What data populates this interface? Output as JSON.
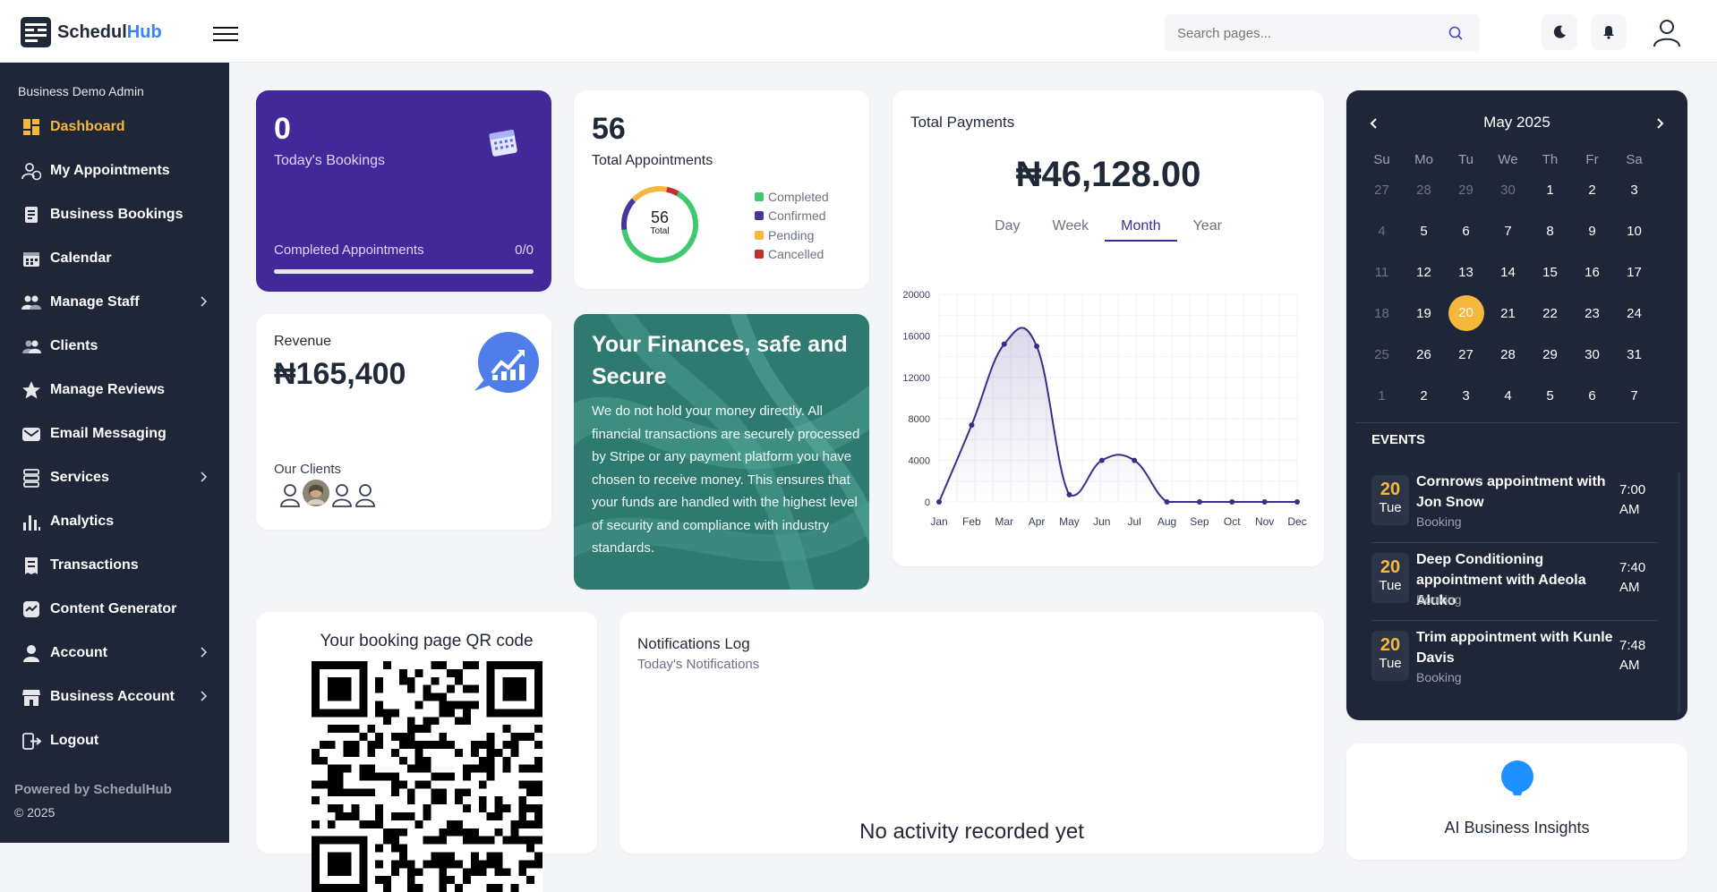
{
  "app": {
    "name_part1": "Schedul",
    "name_part2": "Hub",
    "search_placeholder": "Search pages..."
  },
  "sidebar": {
    "role": "Business Demo Admin",
    "items": [
      {
        "label": "Dashboard",
        "icon": "dashboard-icon",
        "active": true
      },
      {
        "label": "My Appointments",
        "icon": "user-clock-icon"
      },
      {
        "label": "Business Bookings",
        "icon": "booking-icon"
      },
      {
        "label": "Calendar",
        "icon": "calendar-icon"
      },
      {
        "label": "Manage Staff",
        "icon": "staff-icon",
        "chevron": true
      },
      {
        "label": "Clients",
        "icon": "clients-icon"
      },
      {
        "label": "Manage Reviews",
        "icon": "star-icon"
      },
      {
        "label": "Email Messaging",
        "icon": "mail-icon"
      },
      {
        "label": "Services",
        "icon": "services-icon",
        "chevron": true
      },
      {
        "label": "Analytics",
        "icon": "analytics-icon"
      },
      {
        "label": "Transactions",
        "icon": "receipt-icon"
      },
      {
        "label": "Content Generator",
        "icon": "content-icon"
      },
      {
        "label": "Account",
        "icon": "account-icon",
        "chevron": true
      },
      {
        "label": "Business Account",
        "icon": "store-icon",
        "chevron": true
      },
      {
        "label": "Logout",
        "icon": "logout-icon"
      }
    ],
    "powered_by": "Powered by SchedulHub",
    "copyright": "© 2025"
  },
  "bookings": {
    "count": "0",
    "label": "Today's Bookings",
    "completed_label": "Completed Appointments",
    "completed_ratio": "0/0",
    "progress": 0
  },
  "appointments": {
    "count": "56",
    "label": "Total Appointments",
    "donut_value": "56",
    "donut_label": "Total",
    "legend": [
      {
        "name": "Completed",
        "color": "#3ec96e",
        "value": 36
      },
      {
        "name": "Confirmed",
        "color": "#43389a",
        "value": 8
      },
      {
        "name": "Pending",
        "color": "#f6b83c",
        "value": 9
      },
      {
        "name": "Cancelled",
        "color": "#c42d2d",
        "value": 3
      }
    ]
  },
  "payments": {
    "title": "Total Payments",
    "amount": "₦46,128.00",
    "tabs": [
      "Day",
      "Week",
      "Month",
      "Year"
    ],
    "active_tab": "Month"
  },
  "revenue": {
    "label": "Revenue",
    "amount": "₦165,400",
    "clients_label": "Our Clients"
  },
  "finance": {
    "heading": "Your Finances, safe and Secure",
    "body": "We do not hold your money directly. All financial transactions are securely processed by Stripe or any payment platform you have chosen to receive money. This ensures that your funds are handled with the highest level of security and compliance with industry standards."
  },
  "calendar": {
    "month": "May 2025",
    "weekdays": [
      "Su",
      "Mo",
      "Tu",
      "We",
      "Th",
      "Fr",
      "Sa"
    ],
    "weeks": [
      [
        "27",
        "28",
        "29",
        "30",
        "1",
        "2",
        "3"
      ],
      [
        "4",
        "5",
        "6",
        "7",
        "8",
        "9",
        "10"
      ],
      [
        "11",
        "12",
        "13",
        "14",
        "15",
        "16",
        "17"
      ],
      [
        "18",
        "19",
        "20",
        "21",
        "22",
        "23",
        "24"
      ],
      [
        "25",
        "26",
        "27",
        "28",
        "29",
        "30",
        "31"
      ],
      [
        "1",
        "2",
        "3",
        "4",
        "5",
        "6",
        "7"
      ]
    ],
    "today": "20",
    "events_label": "EVENTS",
    "events": [
      {
        "day": "20",
        "weekday": "Tue",
        "title": "Cornrows appointment with Jon Snow",
        "type": "Booking",
        "time": "7:00 AM"
      },
      {
        "day": "20",
        "weekday": "Tue",
        "title": "Deep Conditioning appointment with Adeola Aluko",
        "type": "Booking",
        "time": "7:40 AM"
      },
      {
        "day": "20",
        "weekday": "Tue",
        "title": "Trim appointment with Kunle Davis",
        "type": "Booking",
        "time": "7:48 AM"
      }
    ]
  },
  "qr": {
    "title": "Your booking page QR code"
  },
  "notifications": {
    "title": "Notifications Log",
    "subtitle": "Today's Notifications",
    "empty": "No activity recorded yet"
  },
  "ai": {
    "title": "AI Business Insights"
  },
  "chart_data": {
    "type": "area",
    "categories": [
      "Jan",
      "Feb",
      "Mar",
      "Apr",
      "May",
      "Jun",
      "Jul",
      "Aug",
      "Sep",
      "Oct",
      "Nov",
      "Dec"
    ],
    "values": [
      0,
      7400,
      15200,
      15000,
      700,
      4000,
      4000,
      0,
      0,
      0,
      0,
      0
    ],
    "yticks": [
      "0",
      "4000",
      "8000",
      "12000",
      "16000",
      "20000"
    ],
    "ylim": [
      0,
      20000
    ],
    "line_color": "#3b2e8a",
    "grid": true
  }
}
